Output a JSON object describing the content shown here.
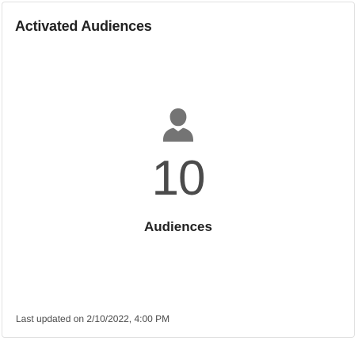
{
  "card": {
    "title": "Activated Audiences",
    "metric": {
      "icon": "user-icon",
      "value": "10",
      "label": "Audiences"
    },
    "footer": "Last updated on 2/10/2022, 4:00 PM"
  },
  "colors": {
    "icon": "#747474",
    "value": "#4b4b4b",
    "text": "#222222",
    "border": "#e1e1e1"
  }
}
